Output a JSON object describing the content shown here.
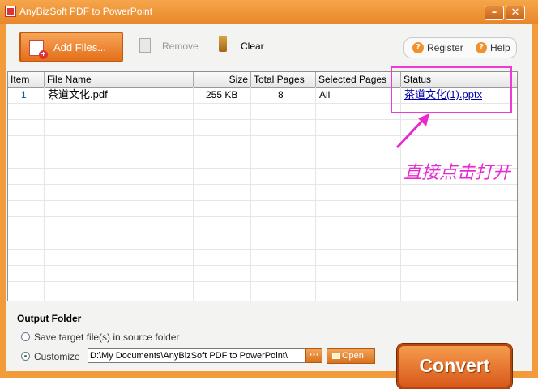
{
  "window": {
    "title": "AnyBizSoft PDF to PowerPoint",
    "minimize_glyph": "–",
    "close_glyph": "✕"
  },
  "toolbar": {
    "add_files": "Add Files...",
    "remove": "Remove",
    "clear": "Clear",
    "register": "Register",
    "help": "Help"
  },
  "list": {
    "columns": [
      "Item",
      "File Name",
      "Size",
      "Total Pages",
      "Selected Pages",
      "Status"
    ],
    "rows": [
      {
        "item": "1",
        "file_name": "茶道文化.pdf",
        "size": "255  KB",
        "total_pages": "8",
        "selected_pages": "All",
        "status": "茶道文化(1).pptx"
      }
    ]
  },
  "annotation": {
    "text": "直接点击打开",
    "color": "#e62ad0"
  },
  "output": {
    "title": "Output Folder",
    "option_source": "Save target file(s) in source folder",
    "option_customize": "Customize",
    "path": "D:\\My Documents\\AnyBizSoft PDF to PowerPoint\\",
    "browse": "···",
    "open": "Open",
    "selected": "Customize"
  },
  "convert": {
    "label": "Convert"
  },
  "colors": {
    "accent": "#f39a3a",
    "link": "#0000aa",
    "highlight": "#ee3bd7"
  }
}
